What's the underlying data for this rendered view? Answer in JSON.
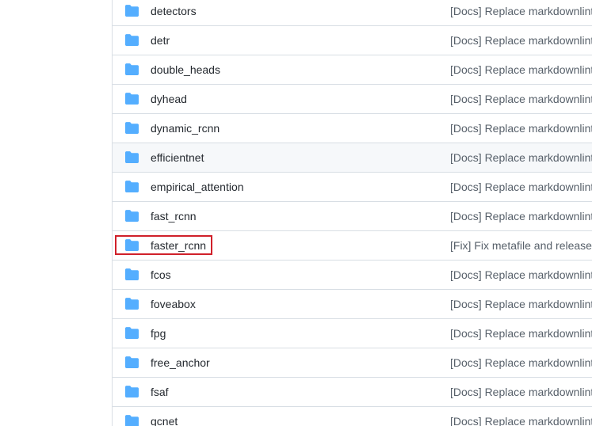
{
  "file_list": {
    "rows": [
      {
        "name": "detectors",
        "commit": "[Docs] Replace markdownlint with mdformat"
      },
      {
        "name": "detr",
        "commit": "[Docs] Replace markdownlint with mdformat"
      },
      {
        "name": "double_heads",
        "commit": "[Docs] Replace markdownlint with mdformat"
      },
      {
        "name": "dyhead",
        "commit": "[Docs] Replace markdownlint with mdformat"
      },
      {
        "name": "dynamic_rcnn",
        "commit": "[Docs] Replace markdownlint with mdformat"
      },
      {
        "name": "efficientnet",
        "commit": "[Docs] Replace markdownlint with mdformat"
      },
      {
        "name": "empirical_attention",
        "commit": "[Docs] Replace markdownlint with mdformat"
      },
      {
        "name": "fast_rcnn",
        "commit": "[Docs] Replace markdownlint with mdformat"
      },
      {
        "name": "faster_rcnn",
        "commit": "[Fix] Fix metafile and release models"
      },
      {
        "name": "fcos",
        "commit": "[Docs] Replace markdownlint with mdformat"
      },
      {
        "name": "foveabox",
        "commit": "[Docs] Replace markdownlint with mdformat"
      },
      {
        "name": "fpg",
        "commit": "[Docs] Replace markdownlint with mdformat"
      },
      {
        "name": "free_anchor",
        "commit": "[Docs] Replace markdownlint with mdformat"
      },
      {
        "name": "fsaf",
        "commit": "[Docs] Replace markdownlint with mdformat"
      },
      {
        "name": "gcnet",
        "commit": "[Docs] Replace markdownlint with mdformat"
      }
    ],
    "hovered_row": "efficientnet",
    "highlighted_row": "faster_rcnn"
  },
  "colors": {
    "folder_icon": "#54aeff",
    "highlight_border": "#d0202a",
    "row_border": "#d8dee4",
    "hover_background": "#f6f8fa"
  },
  "icons": {
    "folder": "folder-icon"
  }
}
